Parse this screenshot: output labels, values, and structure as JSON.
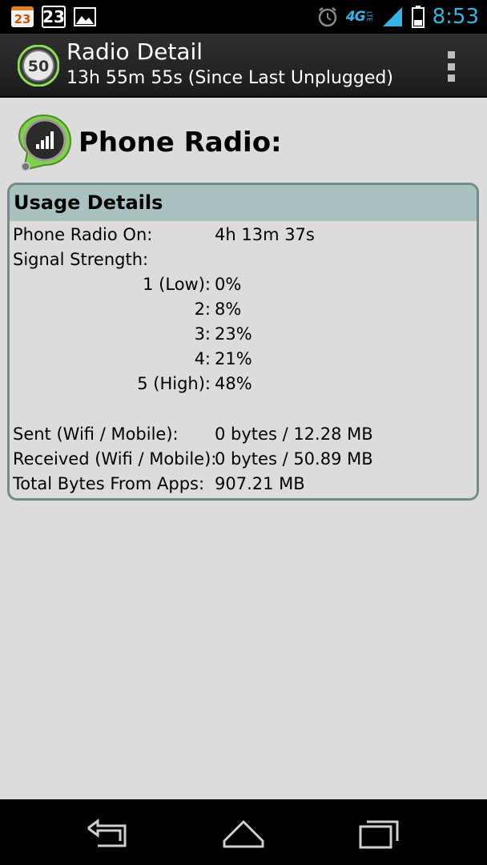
{
  "status_bar": {
    "cal_small": "23",
    "cal_big": "23",
    "network": "4G",
    "network_sub": "LTE",
    "time": "8:53",
    "icons": [
      "calendar-notification-icon",
      "calendar-icon",
      "image-icon",
      "alarm-icon",
      "network-icon",
      "signal-icon",
      "battery-icon"
    ]
  },
  "action_bar": {
    "app_badge": "50",
    "title": "Radio Detail",
    "subtitle": "13h 55m 55s (Since Last Unplugged)",
    "menu_icon": "overflow-menu-icon"
  },
  "section": {
    "title": "Phone Radio:"
  },
  "usage": {
    "header": "Usage Details",
    "phone_radio_on_label": "Phone Radio On:",
    "phone_radio_on_value": "4h 13m 37s",
    "signal_strength_label": "Signal Strength:",
    "signal_levels": [
      {
        "label": "1 (Low):",
        "value": "0%"
      },
      {
        "label": "2:",
        "value": "8%"
      },
      {
        "label": "3:",
        "value": "23%"
      },
      {
        "label": "4:",
        "value": "21%"
      },
      {
        "label": "5 (High):",
        "value": "48%"
      }
    ],
    "sent_label": "Sent (Wifi / Mobile):",
    "sent_value": "0 bytes / 12.28 MB",
    "received_label": "Received (Wifi / Mobile):",
    "received_value": "0 bytes / 50.89 MB",
    "total_label": "Total Bytes From Apps:",
    "total_value": "907.21 MB"
  },
  "colors": {
    "accent": "#33b5e5",
    "card_header": "#a9c1c1",
    "card_border": "#6f8c8c",
    "background": "#dcdcdc"
  }
}
